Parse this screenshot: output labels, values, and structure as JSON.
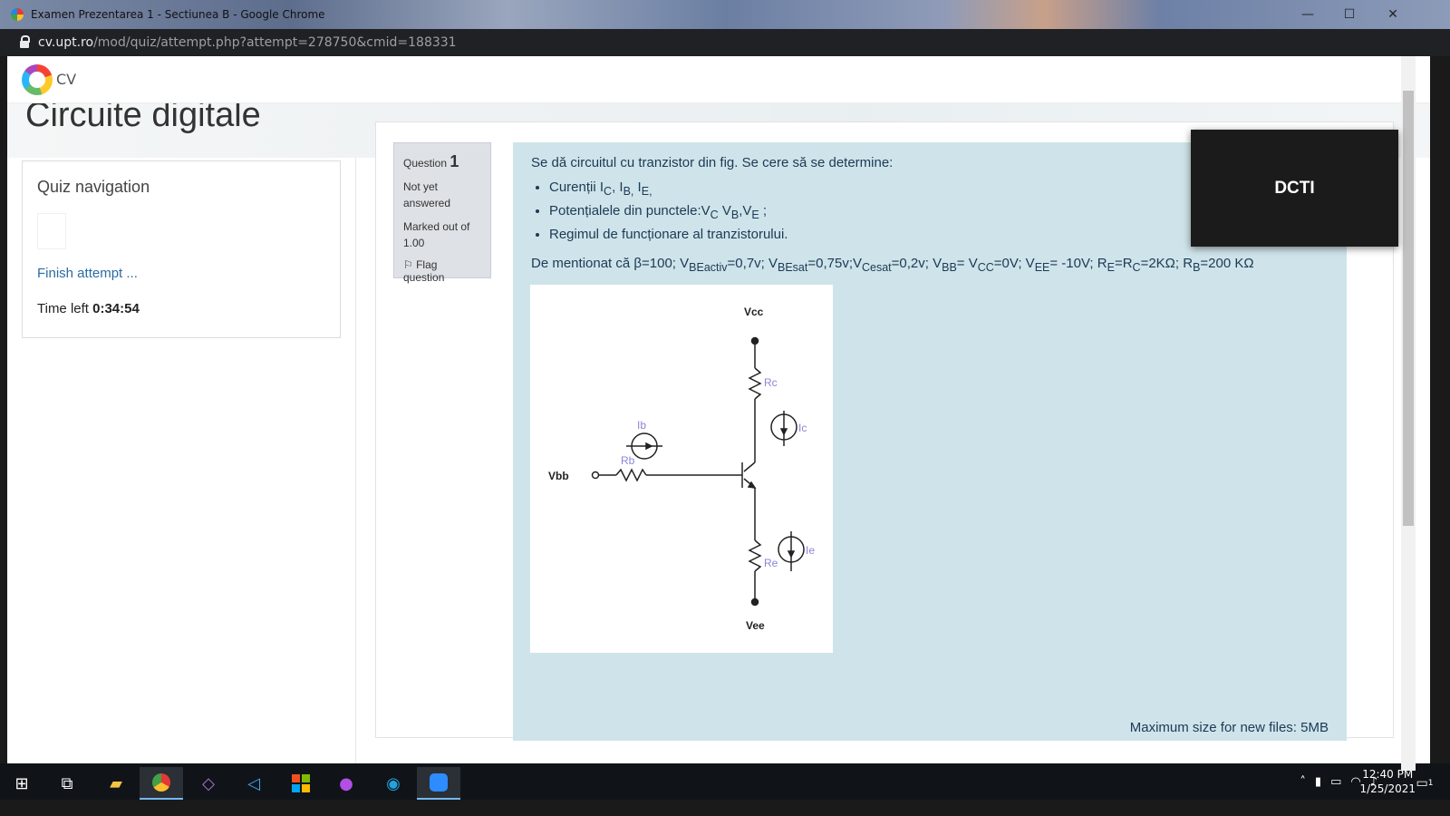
{
  "window": {
    "title": "Examen Prezentarea 1 - Sectiunea B - Google Chrome",
    "minimize": "—",
    "maximize": "☐",
    "close": "✕"
  },
  "browser": {
    "url_host": "cv.upt.ro",
    "url_path": "/mod/quiz/attempt.php?attempt=278750&cmid=188331"
  },
  "site": {
    "name": "CV"
  },
  "course": {
    "title": "Circuite digitale"
  },
  "quiz_nav": {
    "title": "Quiz navigation",
    "finish": "Finish attempt ...",
    "time_label": "Time left",
    "time_value": "0:34:54"
  },
  "question": {
    "label": "Question",
    "number": "1",
    "status": "Not yet answered",
    "marked": "Marked out of 1.00",
    "flag": "Flag question",
    "intro": "Se dă circuitul cu tranzistor din fig. Se cere să se determine:",
    "bullets": [
      "Curenții IC, IB, IE,",
      "Potențialele din punctele:VC VB,VE ;",
      "Regimul de funcționare al tranzistorului."
    ],
    "note": "De mentionat că β=100; VBEactiv=0,7v; VBEsat=0,75v;VCesat=0,2v; VBB= VCC=0V; VEE= -10V; RE=RC=2KΩ; RB=200 KΩ",
    "max_size": "Maximum size for new files: 5MB"
  },
  "circuit": {
    "vcc": "Vcc",
    "vee": "Vee",
    "vbb": "Vbb",
    "rc": "Rc",
    "re": "Re",
    "rb": "Rb",
    "ib": "Ib",
    "ic": "Ic",
    "ie": "Ie"
  },
  "overlay": {
    "label": "DCTI"
  },
  "taskbar": {
    "time": "12:40 PM",
    "date": "1/25/2021",
    "notifications": "1"
  },
  "colors": {
    "content_bg": "#cfe4ea",
    "link": "#2b6ca3",
    "info_bg": "#dee2e6"
  }
}
